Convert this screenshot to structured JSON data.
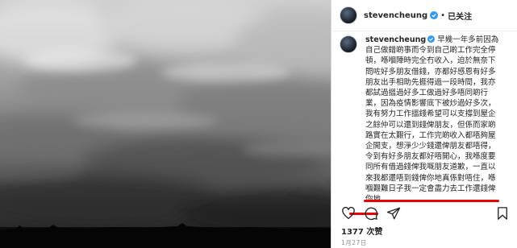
{
  "post": {
    "username": "stevencheung",
    "follow_separator": "•",
    "follow_label": "已关注",
    "caption_author": "stevencheung",
    "caption_text": "早幾一年多前因為自己做錯啲事而令到自己啲工作完全停頓，喺嗰陣時完全冇收入，迫於無奈下問咗好多朋友借錢，亦都好感恩有好多朋友出手相助先捱得過一段時間，我亦都試過搵過好多工做過好多唔同啲行業，因為疫情影響底下被炒過好多次，我有努力工作搵錢希望可以支撐到屋企之餘仲可以還到錢俾朋友，但係而家啲路實在太艱行，工作完啲收入都唔夠屋企開支，想淨少少錢還俾朋友都唔得，令到有好多朋友都好唔開心，我喺度要同所有借過錢俾我嘅朋友道歉，一直以來我都還唔到錢俾你地真係對唔住，喺嗰艱難日子我一定會盡力去工作還錢俾你地",
    "likes": "1377 次赞",
    "date": "1月27日"
  },
  "colors": {
    "highlight_underline": "#e60000",
    "verified_badge": "#3897f0",
    "text": "#262626",
    "muted": "#8e8e8e"
  },
  "icons": {
    "like": "heart-icon",
    "comment": "comment-icon",
    "share": "share-icon",
    "save": "bookmark-icon",
    "verified": "verified-badge-icon"
  }
}
